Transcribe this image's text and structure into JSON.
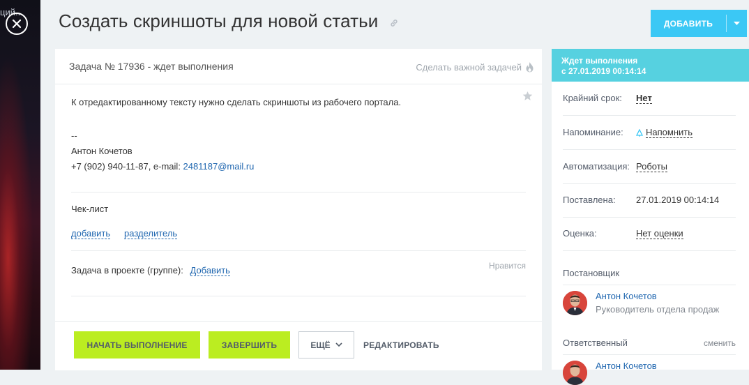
{
  "backdrop": {
    "peek_text": "ций..."
  },
  "header": {
    "title": "Создать скриншоты для новой статьи",
    "add_button": "ДОБАВИТЬ"
  },
  "task": {
    "number_status": "Задача № 17936 - ждет выполнения",
    "make_important": "Сделать важной задачей",
    "description": "К отредактированному тексту нужно сделать скриншоты из рабочего портала.",
    "signature": {
      "dashes": "--",
      "name": "Антон Кочетов",
      "contact_prefix": "+7 (902) 940-11-87, e-mail: ",
      "email": "2481187@mail.ru"
    },
    "checklist": {
      "label": "Чек-лист",
      "add": "добавить",
      "separator": "разделитель"
    },
    "project": {
      "label": "Задача в проекте (группе):",
      "add": "Добавить"
    },
    "likes": "Нравится"
  },
  "actions": {
    "start": "НАЧАТЬ ВЫПОЛНЕНИЕ",
    "finish": "ЗАВЕРШИТЬ",
    "more": "ЕЩЁ",
    "edit": "РЕДАКТИРОВАТЬ"
  },
  "side": {
    "status_line1": "Ждет выполнения",
    "status_line2": "с 27.01.2019 00:14:14",
    "deadline_label": "Крайний срок:",
    "deadline_value": "Нет",
    "reminder_label": "Напоминание:",
    "reminder_value": "Напомнить",
    "automation_label": "Автоматизация:",
    "automation_value": "Роботы",
    "created_label": "Поставлена:",
    "created_value": "27.01.2019 00:14:14",
    "rating_label": "Оценка:",
    "rating_value": "Нет оценки",
    "creator_label": "Постановщик",
    "creator_name": "Антон Кочетов",
    "creator_role": "Руководитель отдела продаж",
    "responsible_label": "Ответственный",
    "responsible_change": "сменить",
    "responsible_name": "Антон Кочетов"
  },
  "colors": {
    "accent_blue": "#3bc8f5",
    "status_cyan": "#56d1e0",
    "action_green": "#bbed21",
    "link_blue": "#2067b0"
  }
}
